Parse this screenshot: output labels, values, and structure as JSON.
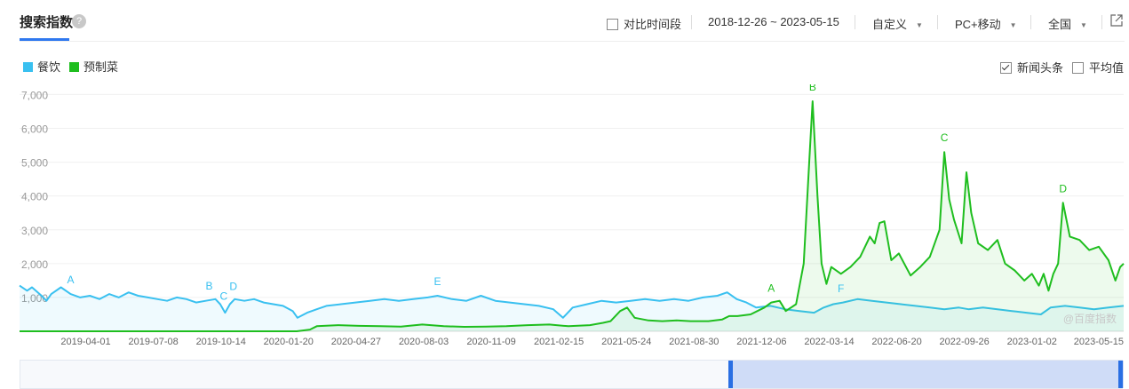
{
  "header": {
    "title": "搜索指数",
    "help_icon": "question-circle-icon",
    "compare_label": "对比时间段",
    "date_range": "2018-12-26 ~ 2023-05-15",
    "custom_label": "自定义",
    "device_label": "PC+移动",
    "region_label": "全国",
    "share_icon": "external-link-icon"
  },
  "options": {
    "news_label": "新闻头条",
    "news_checked": true,
    "average_label": "平均值",
    "average_checked": false
  },
  "watermark": "@百度指数",
  "colors": {
    "series1": "#39c0f0",
    "series2": "#1fbe1f",
    "accent": "#2f78ef"
  },
  "chart_data": {
    "type": "line",
    "yticks": [
      "1,000",
      "2,000",
      "3,000",
      "4,000",
      "5,000",
      "6,000",
      "7,000"
    ],
    "ylim": [
      0,
      7300
    ],
    "xticks": [
      "2019-04-01",
      "2019-07-08",
      "2019-10-14",
      "2020-01-20",
      "2020-04-27",
      "2020-08-03",
      "2020-11-09",
      "2021-02-15",
      "2021-05-24",
      "2021-08-30",
      "2021-12-06",
      "2022-03-14",
      "2022-06-20",
      "2022-09-26",
      "2023-01-02",
      "2023-05-15"
    ],
    "x_start": "2018-12-26",
    "x_end": "2023-05-15",
    "grid": true,
    "legend": "top-left",
    "series": [
      {
        "name": "餐饮",
        "points": [
          [
            "2018-12-26",
            1350
          ],
          [
            "2019-01-06",
            1200
          ],
          [
            "2019-01-13",
            1300
          ],
          [
            "2019-01-27",
            1050
          ],
          [
            "2019-02-03",
            900
          ],
          [
            "2019-02-10",
            1100
          ],
          [
            "2019-02-24",
            1300
          ],
          [
            "2019-03-10",
            1100
          ],
          [
            "2019-03-24",
            1000
          ],
          [
            "2019-04-07",
            1050
          ],
          [
            "2019-04-21",
            950
          ],
          [
            "2019-05-05",
            1100
          ],
          [
            "2019-05-19",
            1000
          ],
          [
            "2019-06-02",
            1150
          ],
          [
            "2019-06-16",
            1050
          ],
          [
            "2019-06-30",
            1000
          ],
          [
            "2019-07-14",
            950
          ],
          [
            "2019-07-28",
            900
          ],
          [
            "2019-08-11",
            1000
          ],
          [
            "2019-08-25",
            950
          ],
          [
            "2019-09-08",
            850
          ],
          [
            "2019-09-22",
            900
          ],
          [
            "2019-10-06",
            950
          ],
          [
            "2019-10-13",
            800
          ],
          [
            "2019-10-20",
            550
          ],
          [
            "2019-10-27",
            800
          ],
          [
            "2019-11-03",
            950
          ],
          [
            "2019-11-17",
            900
          ],
          [
            "2019-12-01",
            950
          ],
          [
            "2019-12-15",
            850
          ],
          [
            "2019-12-29",
            800
          ],
          [
            "2020-01-12",
            750
          ],
          [
            "2020-01-26",
            600
          ],
          [
            "2020-02-02",
            400
          ],
          [
            "2020-02-16",
            550
          ],
          [
            "2020-03-01",
            650
          ],
          [
            "2020-03-15",
            750
          ],
          [
            "2020-04-05",
            800
          ],
          [
            "2020-04-26",
            850
          ],
          [
            "2020-05-17",
            900
          ],
          [
            "2020-06-07",
            950
          ],
          [
            "2020-06-28",
            900
          ],
          [
            "2020-07-19",
            950
          ],
          [
            "2020-08-09",
            1000
          ],
          [
            "2020-08-23",
            1050
          ],
          [
            "2020-09-13",
            950
          ],
          [
            "2020-10-04",
            900
          ],
          [
            "2020-10-25",
            1050
          ],
          [
            "2020-11-15",
            900
          ],
          [
            "2020-12-06",
            850
          ],
          [
            "2020-12-27",
            800
          ],
          [
            "2021-01-17",
            750
          ],
          [
            "2021-02-07",
            650
          ],
          [
            "2021-02-21",
            400
          ],
          [
            "2021-03-07",
            700
          ],
          [
            "2021-03-28",
            800
          ],
          [
            "2021-04-18",
            900
          ],
          [
            "2021-05-09",
            850
          ],
          [
            "2021-05-30",
            900
          ],
          [
            "2021-06-20",
            950
          ],
          [
            "2021-07-11",
            900
          ],
          [
            "2021-08-01",
            950
          ],
          [
            "2021-08-22",
            900
          ],
          [
            "2021-09-12",
            1000
          ],
          [
            "2021-10-03",
            1050
          ],
          [
            "2021-10-17",
            1150
          ],
          [
            "2021-10-31",
            950
          ],
          [
            "2021-11-14",
            850
          ],
          [
            "2021-11-28",
            700
          ],
          [
            "2021-12-19",
            750
          ],
          [
            "2022-01-09",
            650
          ],
          [
            "2022-01-30",
            600
          ],
          [
            "2022-02-20",
            550
          ],
          [
            "2022-03-06",
            700
          ],
          [
            "2022-03-20",
            800
          ],
          [
            "2022-04-03",
            850
          ],
          [
            "2022-04-24",
            950
          ],
          [
            "2022-05-15",
            900
          ],
          [
            "2022-06-05",
            850
          ],
          [
            "2022-06-26",
            800
          ],
          [
            "2022-07-17",
            750
          ],
          [
            "2022-08-07",
            700
          ],
          [
            "2022-08-28",
            650
          ],
          [
            "2022-09-18",
            700
          ],
          [
            "2022-10-02",
            650
          ],
          [
            "2022-10-23",
            700
          ],
          [
            "2022-11-13",
            650
          ],
          [
            "2022-12-04",
            600
          ],
          [
            "2022-12-25",
            550
          ],
          [
            "2023-01-15",
            500
          ],
          [
            "2023-01-29",
            700
          ],
          [
            "2023-02-19",
            750
          ],
          [
            "2023-03-12",
            700
          ],
          [
            "2023-04-02",
            650
          ],
          [
            "2023-04-23",
            700
          ],
          [
            "2023-05-15",
            750
          ]
        ]
      },
      {
        "name": "预制菜",
        "points": [
          [
            "2018-12-26",
            0
          ],
          [
            "2020-02-01",
            0
          ],
          [
            "2020-02-20",
            50
          ],
          [
            "2020-03-01",
            150
          ],
          [
            "2020-04-01",
            180
          ],
          [
            "2020-05-01",
            160
          ],
          [
            "2020-06-01",
            150
          ],
          [
            "2020-07-01",
            140
          ],
          [
            "2020-08-01",
            200
          ],
          [
            "2020-09-01",
            150
          ],
          [
            "2020-10-01",
            130
          ],
          [
            "2020-11-01",
            140
          ],
          [
            "2020-12-01",
            150
          ],
          [
            "2021-01-01",
            180
          ],
          [
            "2021-02-01",
            200
          ],
          [
            "2021-03-01",
            150
          ],
          [
            "2021-04-01",
            180
          ],
          [
            "2021-04-20",
            250
          ],
          [
            "2021-05-01",
            300
          ],
          [
            "2021-05-15",
            600
          ],
          [
            "2021-05-25",
            700
          ],
          [
            "2021-06-05",
            400
          ],
          [
            "2021-06-25",
            320
          ],
          [
            "2021-07-15",
            300
          ],
          [
            "2021-08-05",
            320
          ],
          [
            "2021-08-25",
            300
          ],
          [
            "2021-09-20",
            300
          ],
          [
            "2021-10-10",
            350
          ],
          [
            "2021-10-20",
            450
          ],
          [
            "2021-11-01",
            450
          ],
          [
            "2021-11-20",
            500
          ],
          [
            "2021-12-10",
            700
          ],
          [
            "2021-12-20",
            850
          ],
          [
            "2022-01-01",
            900
          ],
          [
            "2022-01-10",
            600
          ],
          [
            "2022-01-25",
            800
          ],
          [
            "2022-02-05",
            2000
          ],
          [
            "2022-02-13",
            5000
          ],
          [
            "2022-02-18",
            6800
          ],
          [
            "2022-02-25",
            4000
          ],
          [
            "2022-03-03",
            2000
          ],
          [
            "2022-03-10",
            1400
          ],
          [
            "2022-03-17",
            1900
          ],
          [
            "2022-03-31",
            1700
          ],
          [
            "2022-04-14",
            1900
          ],
          [
            "2022-04-28",
            2200
          ],
          [
            "2022-05-12",
            2800
          ],
          [
            "2022-05-19",
            2600
          ],
          [
            "2022-05-26",
            3200
          ],
          [
            "2022-06-02",
            3250
          ],
          [
            "2022-06-12",
            2100
          ],
          [
            "2022-06-23",
            2300
          ],
          [
            "2022-07-10",
            1650
          ],
          [
            "2022-07-24",
            1900
          ],
          [
            "2022-08-07",
            2200
          ],
          [
            "2022-08-21",
            3000
          ],
          [
            "2022-08-28",
            5300
          ],
          [
            "2022-09-04",
            3900
          ],
          [
            "2022-09-11",
            3300
          ],
          [
            "2022-09-22",
            2600
          ],
          [
            "2022-09-29",
            4700
          ],
          [
            "2022-10-06",
            3500
          ],
          [
            "2022-10-16",
            2600
          ],
          [
            "2022-10-30",
            2400
          ],
          [
            "2022-11-13",
            2700
          ],
          [
            "2022-11-24",
            2000
          ],
          [
            "2022-12-08",
            1800
          ],
          [
            "2022-12-22",
            1500
          ],
          [
            "2023-01-02",
            1700
          ],
          [
            "2023-01-12",
            1350
          ],
          [
            "2023-01-19",
            1700
          ],
          [
            "2023-01-26",
            1200
          ],
          [
            "2023-02-02",
            1700
          ],
          [
            "2023-02-09",
            2000
          ],
          [
            "2023-02-16",
            3800
          ],
          [
            "2023-02-26",
            2800
          ],
          [
            "2023-03-12",
            2700
          ],
          [
            "2023-03-26",
            2400
          ],
          [
            "2023-04-09",
            2500
          ],
          [
            "2023-04-23",
            2100
          ],
          [
            "2023-05-03",
            1500
          ],
          [
            "2023-05-10",
            1900
          ],
          [
            "2023-05-15",
            2000
          ]
        ]
      }
    ],
    "annotations": [
      {
        "series": 0,
        "label": "A",
        "date": "2019-03-10"
      },
      {
        "series": 0,
        "label": "B",
        "date": "2019-09-27"
      },
      {
        "series": 0,
        "label": "C",
        "date": "2019-10-18"
      },
      {
        "series": 0,
        "label": "D",
        "date": "2019-11-01"
      },
      {
        "series": 0,
        "label": "E",
        "date": "2020-08-23"
      },
      {
        "series": 0,
        "label": "F",
        "date": "2022-03-31"
      },
      {
        "series": 1,
        "label": "A",
        "date": "2021-12-20"
      },
      {
        "series": 1,
        "label": "B",
        "date": "2022-02-18"
      },
      {
        "series": 1,
        "label": "C",
        "date": "2022-08-28"
      },
      {
        "series": 1,
        "label": "D",
        "date": "2023-02-16"
      }
    ]
  }
}
